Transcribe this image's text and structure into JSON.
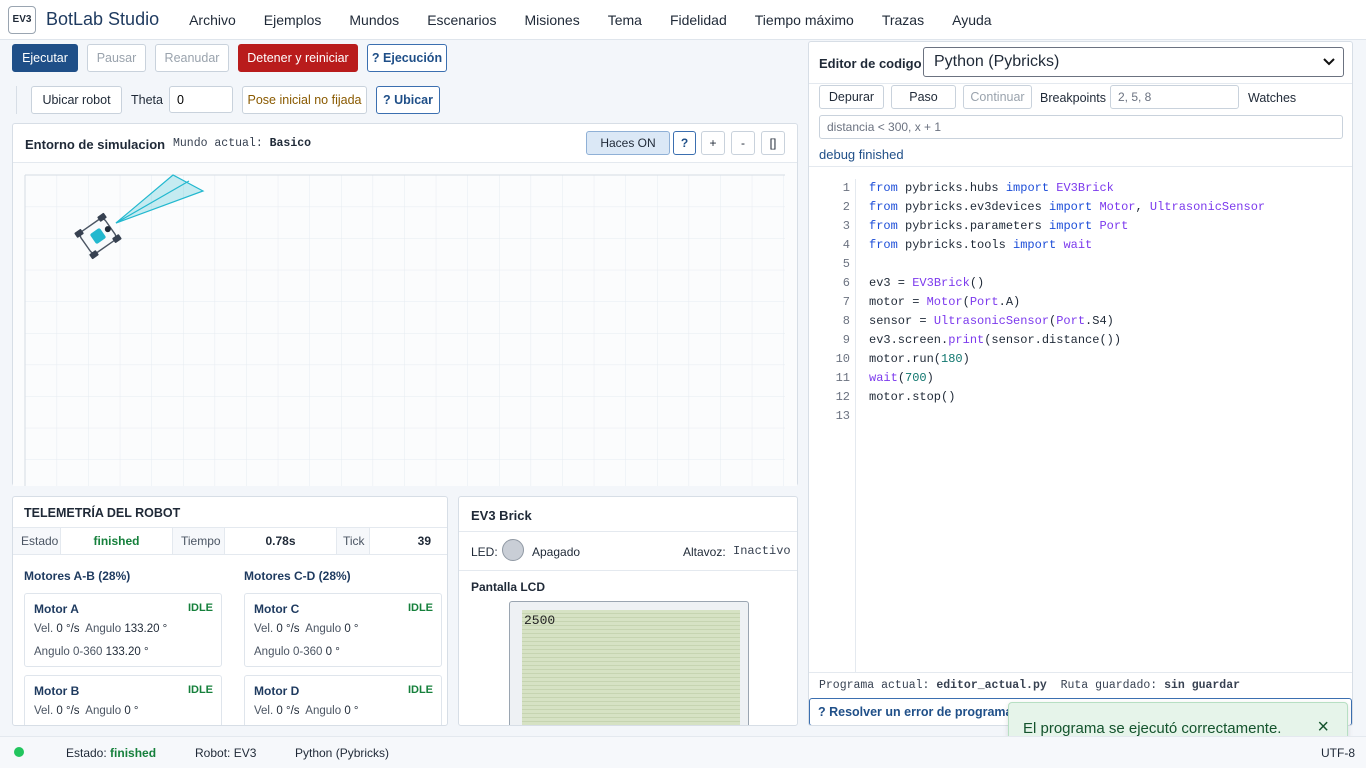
{
  "app": {
    "logo": "EV3",
    "title": "BotLab Studio"
  },
  "menu": [
    "Archivo",
    "Ejemplos",
    "Mundos",
    "Escenarios",
    "Misiones",
    "Tema",
    "Fidelidad",
    "Tiempo máximo",
    "Trazas",
    "Ayuda"
  ],
  "toolbar": {
    "run": "Ejecutar",
    "pause": "Pausar",
    "resume": "Reanudar",
    "stop": "Detener y reiniciar",
    "exec_help": "? Ejecución",
    "locate": "Ubicar robot",
    "theta_label": "Theta",
    "theta_value": "0",
    "pose_status": "Pose inicial no fijada",
    "locate_help": "? Ubicar"
  },
  "sim": {
    "title": "Entorno de simulacion",
    "world_label": "Mundo actual:",
    "world_value": "Basico",
    "rays_toggle": "Haces ON",
    "help": "?",
    "zoom_in": "+",
    "zoom_out": "-",
    "fullscreen": "[]",
    "sensor_color": "#22b8cf"
  },
  "telemetry": {
    "title": "TELEMETRÍA DEL ROBOT",
    "state_label": "Estado",
    "state_value": "finished",
    "time_label": "Tiempo",
    "time_value": "0.78s",
    "tick_label": "Tick",
    "tick_value": "39",
    "group_ab": "Motores A-B (28%)",
    "group_cd": "Motores C-D (28%)",
    "motors": [
      {
        "name": "Motor A",
        "state": "IDLE",
        "vel_label": "Vel.",
        "vel": "0 °/s",
        "ang_label": "Angulo",
        "ang": "133.20 °",
        "mod_label": "Angulo 0-360",
        "mod": "133.20 °"
      },
      {
        "name": "Motor C",
        "state": "IDLE",
        "vel_label": "Vel.",
        "vel": "0 °/s",
        "ang_label": "Angulo",
        "ang": "0 °",
        "mod_label": "Angulo 0-360",
        "mod": "0 °"
      },
      {
        "name": "Motor B",
        "state": "IDLE",
        "vel_label": "Vel.",
        "vel": "0 °/s",
        "ang_label": "Angulo",
        "ang": "0 °"
      },
      {
        "name": "Motor D",
        "state": "IDLE",
        "vel_label": "Vel.",
        "vel": "0 °/s",
        "ang_label": "Angulo",
        "ang": "0 °"
      }
    ]
  },
  "brick": {
    "title": "EV3 Brick",
    "led_label": "LED:",
    "led_state": "Apagado",
    "speaker_label": "Altavoz:",
    "speaker_state": "Inactivo",
    "lcd_title": "Pantalla LCD",
    "lcd_text": "2500",
    "lcd_color": "#d6e2c4"
  },
  "editor": {
    "title": "Editor de codigo",
    "language": "Python (Pybricks)",
    "debug": "Depurar",
    "step": "Paso",
    "continue": "Continuar",
    "breakpoints_label": "Breakpoints",
    "breakpoints_value": "2, 5, 8",
    "watches_label": "Watches",
    "watches_value": "distancia < 300, x + 1",
    "debug_status": "debug finished",
    "line_numbers": [
      "1",
      "2",
      "3",
      "4",
      "5",
      "6",
      "7",
      "8",
      "9",
      "10",
      "11",
      "12",
      "13"
    ],
    "program_label": "Programa actual:",
    "program_value": "editor_actual.py",
    "path_label": "Ruta guardado:",
    "path_value": "sin guardar",
    "resolve_help": "? Resolver un error de programa"
  },
  "toast": {
    "message": "El programa se ejecutó correctamente.",
    "close": "×"
  },
  "statusbar": {
    "state_label": "Estado:",
    "state_value": "finished",
    "robot": "Robot: EV3",
    "language": "Python (Pybricks)",
    "encoding": "UTF-8",
    "dot_color": "#22c55e"
  }
}
